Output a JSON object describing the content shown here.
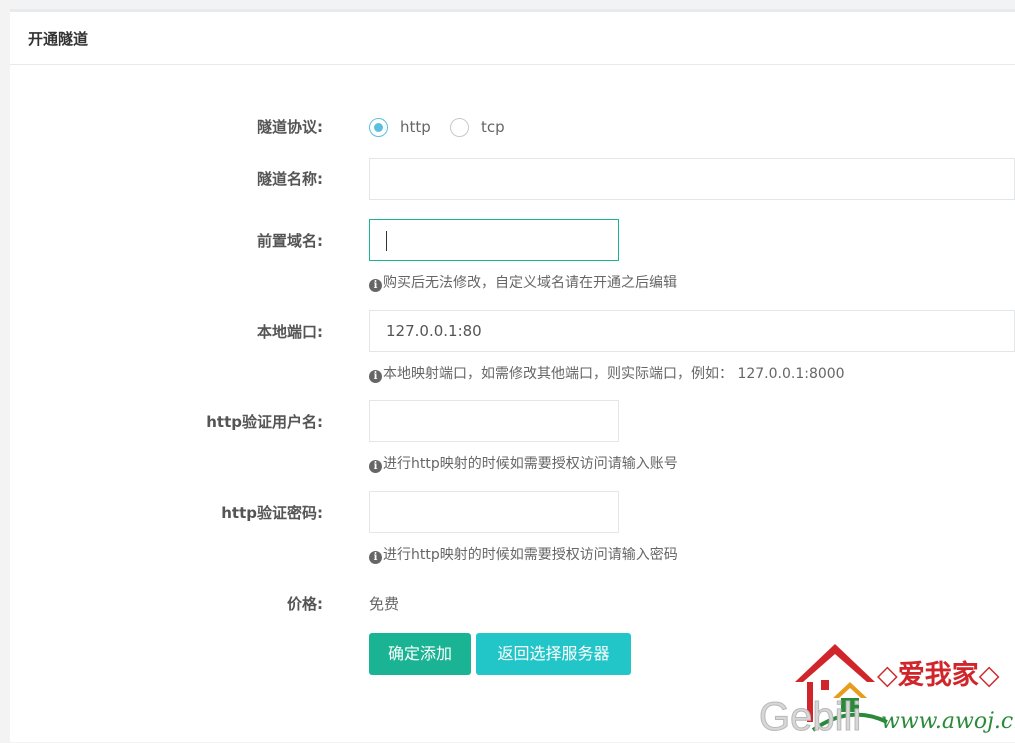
{
  "panel": {
    "title": "开通隧道"
  },
  "form": {
    "protocol": {
      "label": "隧道协议:",
      "options": [
        "http",
        "tcp"
      ],
      "selected": "http"
    },
    "name": {
      "label": "隧道名称:",
      "value": ""
    },
    "domain": {
      "label": "前置域名:",
      "value": "",
      "help": "购买后无法修改，自定义域名请在开通之后编辑"
    },
    "port": {
      "label": "本地端口:",
      "value": "127.0.0.1:80",
      "help": "本地映射端口，如需修改其他端口，则实际端口，例如： 127.0.0.1:8000"
    },
    "http_user": {
      "label": "http验证用户名:",
      "value": "",
      "help": "进行http映射的时候如需要授权访问请输入账号"
    },
    "http_pass": {
      "label": "http验证密码:",
      "value": "",
      "help": "进行http映射的时候如需要授权访问请输入密码"
    },
    "price": {
      "label": "价格:",
      "value": "免费"
    },
    "buttons": {
      "confirm": "确定添加",
      "back": "返回选择服务器"
    }
  },
  "watermark": {
    "brand": "◇爱我家◇",
    "site": "Gebili",
    "url": "www.awoj.cn"
  },
  "colors": {
    "primary": "#1ab394",
    "info": "#23c6c8",
    "radio_checked": "#5bc0de"
  }
}
